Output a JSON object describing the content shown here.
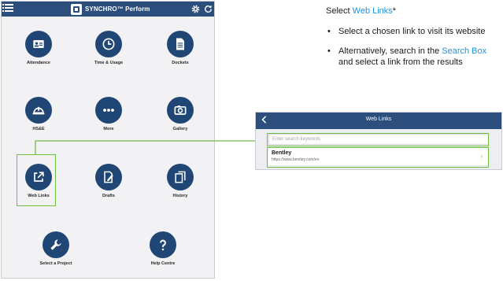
{
  "app": {
    "brand_title": "SYNCHRO™ Perform",
    "tiles": [
      {
        "label": "Attendance",
        "icon": "id-card-icon"
      },
      {
        "label": "Time & Usage",
        "icon": "clock-icon"
      },
      {
        "label": "Dockets",
        "icon": "document-icon"
      },
      {
        "label": "HS&E",
        "icon": "hard-hat-icon"
      },
      {
        "label": "More",
        "icon": "more-dots-icon"
      },
      {
        "label": "Gallery",
        "icon": "camera-icon"
      },
      {
        "label": "Web Links",
        "icon": "external-link-icon"
      },
      {
        "label": "Drafts",
        "icon": "draft-edit-icon"
      },
      {
        "label": "History",
        "icon": "history-copy-icon"
      },
      {
        "label": "Select a Project",
        "icon": "wrench-icon"
      },
      {
        "label": "Help Centre",
        "icon": "help-question-icon"
      }
    ]
  },
  "instructions": {
    "title_prefix": "Select ",
    "title_link": "Web Links",
    "title_suffix": "*",
    "bullet1": "Select a chosen link to visit its website",
    "bullet2_prefix": "Alternatively, search in the ",
    "bullet2_link": "Search Box",
    "bullet2_suffix": " and select a link from the results"
  },
  "web_links_panel": {
    "title": "Web Links",
    "back_icon": "chevron-left-icon",
    "search_placeholder": "Enter search keywords",
    "results": [
      {
        "title": "Bentley",
        "url": "https://www.bentley.com/en"
      }
    ]
  },
  "colors": {
    "header": "#2b4e7d",
    "tile_circle": "#1f4675",
    "highlight": "#6fbd44",
    "link_blue": "#1f95d8"
  }
}
